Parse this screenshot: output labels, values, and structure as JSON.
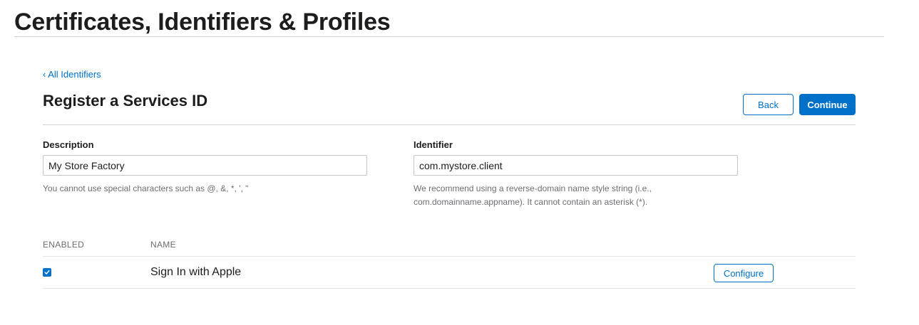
{
  "page": {
    "title": "Certificates, Identifiers & Profiles"
  },
  "nav": {
    "back_link": "‹ All Identifiers"
  },
  "form": {
    "title": "Register a Services ID",
    "back_label": "Back",
    "continue_label": "Continue",
    "description": {
      "label": "Description",
      "value": "My Store Factory",
      "help": "You cannot use special characters such as @, &, *, ', \""
    },
    "identifier": {
      "label": "Identifier",
      "value": "com.mystore.client",
      "help_line1": "We recommend using a reverse-domain name style string (i.e.,",
      "help_line2": "com.domainname.appname). It cannot contain an asterisk (*)."
    }
  },
  "capabilities": {
    "col_enabled": "ENABLED",
    "col_name": "NAME",
    "rows": [
      {
        "enabled": true,
        "name": "Sign In with Apple",
        "action_label": "Configure"
      }
    ]
  },
  "colors": {
    "accent": "#0070c9",
    "text": "#1d1d1f",
    "muted": "#6e6e73",
    "divider": "#d2d2d7"
  },
  "icons": {
    "checkbox": "checkmark-icon"
  }
}
